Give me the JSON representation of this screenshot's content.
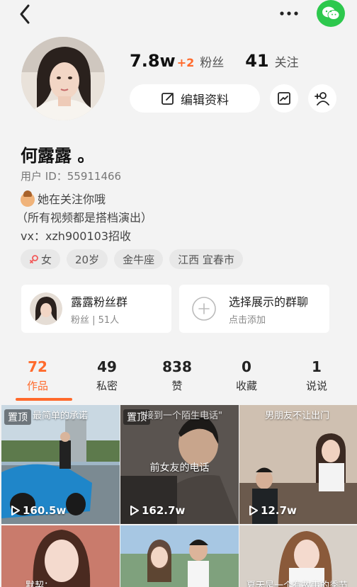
{
  "header": {
    "back_icon": "chevron-left-icon",
    "more_icon": "more-horizontal-icon",
    "wechat_icon": "wechat-icon"
  },
  "profile": {
    "followers": "7.8w",
    "followers_delta": "+2",
    "followers_label": "粉丝",
    "following": "41",
    "following_label": "关注",
    "edit_label": "编辑资料",
    "name": "何露露 。",
    "user_id": "用户 ID：55911466",
    "bio_line1": "她在关注你哦",
    "bio_line2": "（所有视频都是搭档演出）",
    "bio_line3": "vx：xzh900103招收",
    "tags": [
      "女",
      "20岁",
      "金牛座",
      "江西 宜春市"
    ]
  },
  "cards": {
    "fan_group_title": "露露粉丝群",
    "fan_group_sub": "粉丝 | 51人",
    "select_group_title": "选择展示的群聊",
    "select_group_sub": "点击添加"
  },
  "tabs": [
    {
      "count": "72",
      "label": "作品"
    },
    {
      "count": "49",
      "label": "私密"
    },
    {
      "count": "838",
      "label": "赞"
    },
    {
      "count": "0",
      "label": "收藏"
    },
    {
      "count": "1",
      "label": "说说"
    }
  ],
  "videos": [
    {
      "pin": "置顶",
      "caption": "最简单的承诺",
      "views": "160.5w"
    },
    {
      "pin": "置顶",
      "caption": "\"接到一个陌生电话\"",
      "subtitle": "前女友的电话",
      "views": "162.7w"
    },
    {
      "caption": "男朋友不让出门",
      "views": "12.7w"
    },
    {
      "caption": "默契：",
      "views": ""
    },
    {
      "caption": "",
      "views": ""
    },
    {
      "caption": "夏天是一个有故事的季节",
      "views": ""
    }
  ],
  "colors": {
    "accent": "#ff6a2c",
    "wechat": "#2dc84d"
  }
}
